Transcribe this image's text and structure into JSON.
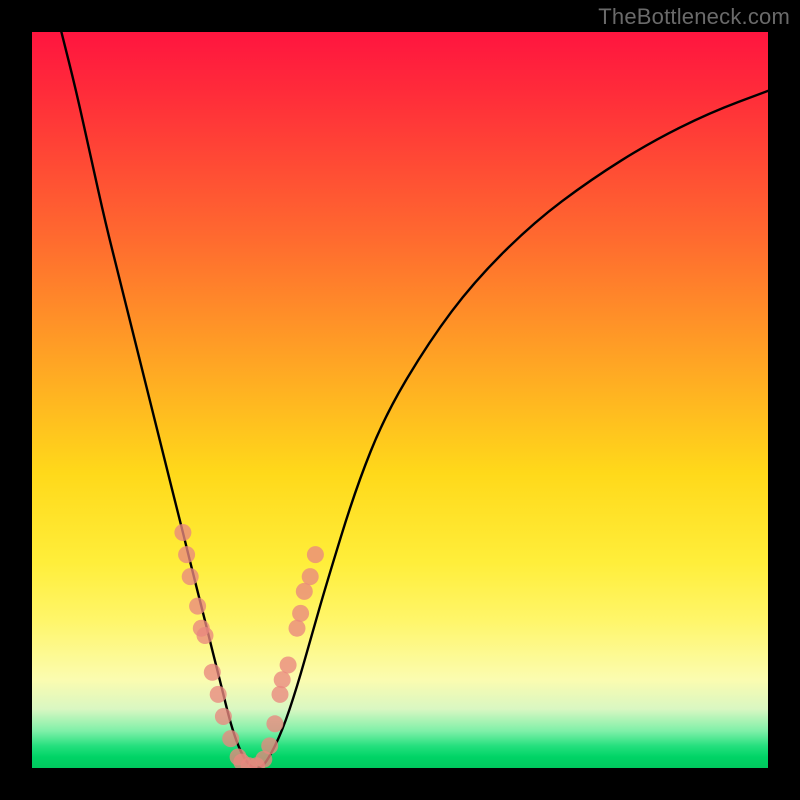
{
  "watermark": "TheBottleneck.com",
  "colors": {
    "marker": "#e9887f",
    "curve": "#000000",
    "frame": "#000000"
  },
  "chart_data": {
    "type": "line",
    "title": "",
    "xlabel": "",
    "ylabel": "",
    "xlim": [
      0,
      100
    ],
    "ylim": [
      0,
      100
    ],
    "grid": false,
    "legend": false,
    "series": [
      {
        "name": "bottleneck-curve",
        "x": [
          4,
          6,
          8,
          10,
          12,
          14,
          16,
          18,
          20,
          21,
          22,
          23,
          24,
          25,
          26,
          27,
          28,
          29,
          30,
          31,
          32,
          34,
          36,
          38,
          40,
          44,
          48,
          54,
          60,
          68,
          76,
          84,
          92,
          100
        ],
        "y": [
          100,
          92,
          83,
          74,
          66,
          58,
          50,
          42,
          34,
          30,
          26,
          22,
          18,
          14,
          10,
          6,
          3,
          1,
          0,
          0,
          1,
          5,
          11,
          18,
          25,
          38,
          48,
          58,
          66,
          74,
          80,
          85,
          89,
          92
        ]
      }
    ],
    "markers": {
      "comment": "salmon dots clustered near the valley on both arms",
      "points": [
        {
          "x": 20.5,
          "y": 32
        },
        {
          "x": 21.0,
          "y": 29
        },
        {
          "x": 21.5,
          "y": 26
        },
        {
          "x": 22.5,
          "y": 22
        },
        {
          "x": 23.0,
          "y": 19
        },
        {
          "x": 23.5,
          "y": 18
        },
        {
          "x": 24.5,
          "y": 13
        },
        {
          "x": 25.3,
          "y": 10
        },
        {
          "x": 26.0,
          "y": 7
        },
        {
          "x": 27.0,
          "y": 4
        },
        {
          "x": 28.0,
          "y": 1.5
        },
        {
          "x": 28.5,
          "y": 0.8
        },
        {
          "x": 29.5,
          "y": 0.3
        },
        {
          "x": 30.5,
          "y": 0.3
        },
        {
          "x": 31.5,
          "y": 1.2
        },
        {
          "x": 32.3,
          "y": 3
        },
        {
          "x": 33.0,
          "y": 6
        },
        {
          "x": 33.7,
          "y": 10
        },
        {
          "x": 34.0,
          "y": 12
        },
        {
          "x": 34.8,
          "y": 14
        },
        {
          "x": 36.0,
          "y": 19
        },
        {
          "x": 36.5,
          "y": 21
        },
        {
          "x": 37.0,
          "y": 24
        },
        {
          "x": 37.8,
          "y": 26
        },
        {
          "x": 38.5,
          "y": 29
        }
      ]
    }
  }
}
